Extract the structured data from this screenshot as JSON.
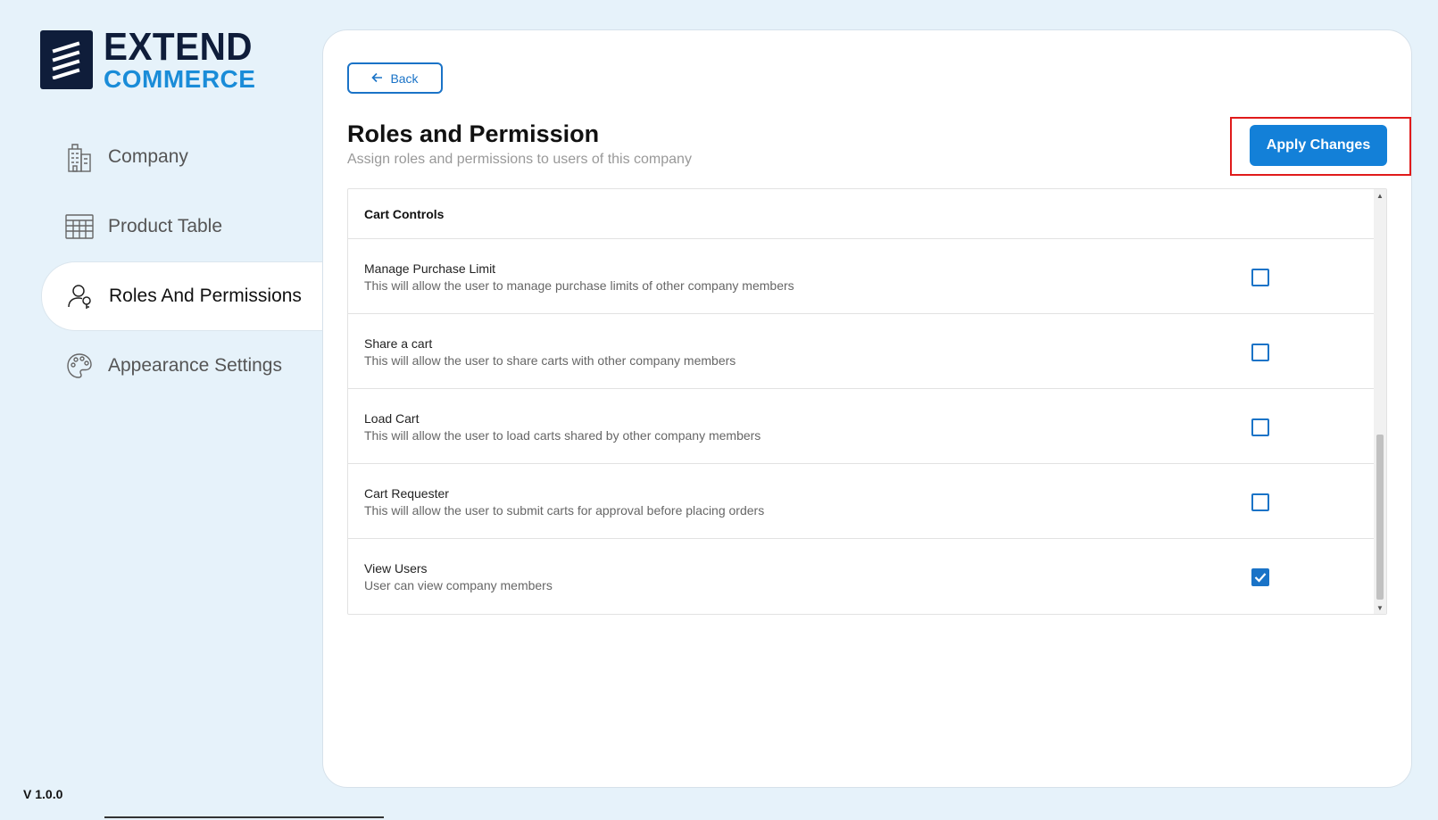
{
  "brand": {
    "line1": "EXTEND",
    "line2": "COMMERCE"
  },
  "sidebar": {
    "items": [
      {
        "label": "Company",
        "icon": "building-icon",
        "active": false
      },
      {
        "label": "Product Table",
        "icon": "table-icon",
        "active": false
      },
      {
        "label": "Roles And Permissions",
        "icon": "user-key-icon",
        "active": true
      },
      {
        "label": "Appearance Settings",
        "icon": "palette-icon",
        "active": false
      }
    ]
  },
  "version": "V 1.0.0",
  "header": {
    "back_label": "Back",
    "title": "Roles and Permission",
    "subtitle": "Assign roles and permissions to users of this company",
    "apply_label": "Apply Changes"
  },
  "permissions": {
    "section_title": "Cart Controls",
    "rows": [
      {
        "name": "Manage Purchase Limit",
        "description": "This will allow the user to manage purchase limits of other company members",
        "checked": false
      },
      {
        "name": "Share a cart",
        "description": "This will allow the user to share carts with other company members",
        "checked": false
      },
      {
        "name": "Load Cart",
        "description": "This will allow the user to load carts shared by other company members",
        "checked": false
      },
      {
        "name": "Cart Requester",
        "description": "This will allow the user to submit carts for approval before placing orders",
        "checked": false
      },
      {
        "name": "View Users",
        "description": "User can view company members",
        "checked": true
      }
    ]
  },
  "colors": {
    "accent": "#1380d8",
    "brand_dark": "#0f1d3a",
    "brand_blue": "#1a8cd8",
    "highlight": "#e01b1b",
    "background": "#e6f2fa"
  }
}
